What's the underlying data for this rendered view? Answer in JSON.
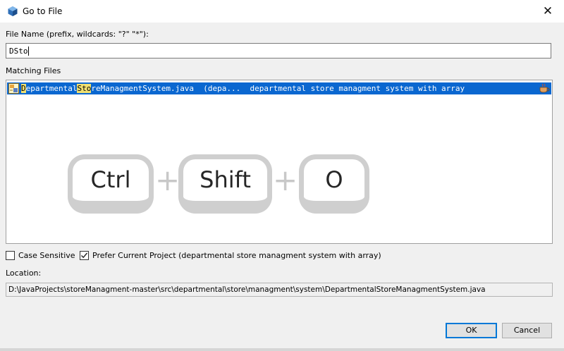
{
  "window": {
    "title": "Go to File",
    "close_glyph": "✕"
  },
  "file_name": {
    "label": "File Name (prefix, wildcards: \"?\" \"*\"):",
    "value": "DSto"
  },
  "matching": {
    "label": "Matching Files",
    "items": [
      {
        "parts": [
          "",
          "D",
          "epartmental",
          "Sto",
          "reManagmentSystem.java"
        ],
        "details": "  (depa...  departmental store managment system with array",
        "icon": "java-file-icon",
        "project_icon": "coffee-cup-icon"
      }
    ]
  },
  "overlay": {
    "key1": "Ctrl",
    "plus1": "+",
    "key2": "Shift",
    "plus2": "+",
    "key3": "O"
  },
  "options": {
    "case_sensitive": {
      "label": "Case Sensitive",
      "checked": false
    },
    "prefer_current": {
      "label": "Prefer Current Project (departmental store managment system with array)",
      "checked": true
    }
  },
  "location": {
    "label": "Location:",
    "value": "D:\\JavaProjects\\storeManagment-master\\src\\departmental\\store\\managment\\system\\DepartmentalStoreManagmentSystem.java"
  },
  "buttons": {
    "ok": "OK",
    "cancel": "Cancel"
  },
  "colors": {
    "selection": "#0a67d0",
    "match_highlight": "#f0e070",
    "dialog_bg": "#f0f0f0"
  }
}
